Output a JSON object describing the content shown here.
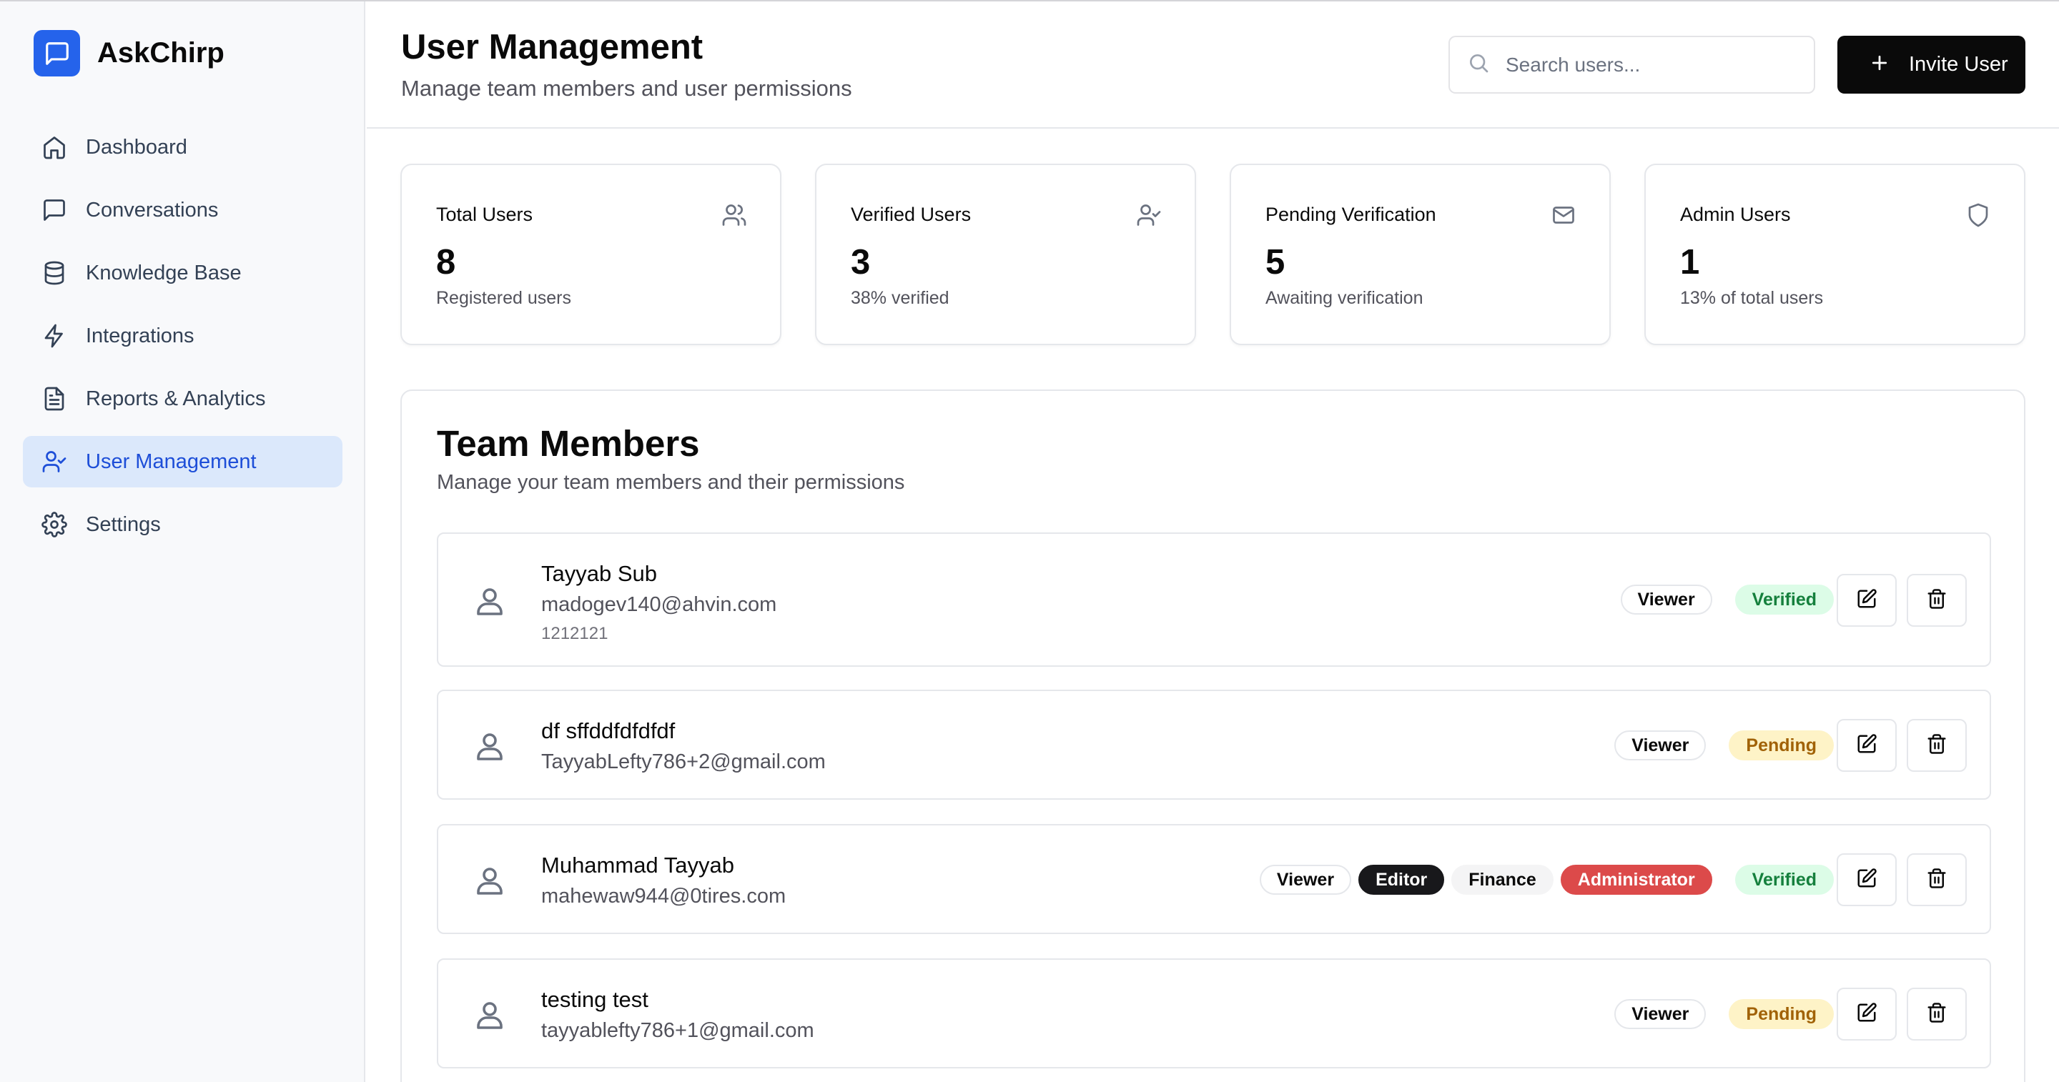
{
  "brand": {
    "name": "AskChirp",
    "logo_icon": "chat-bubble-icon",
    "accent_color": "#2563eb"
  },
  "sidebar": {
    "items": [
      {
        "label": "Dashboard",
        "icon": "home-icon",
        "active": false
      },
      {
        "label": "Conversations",
        "icon": "message-square-icon",
        "active": false
      },
      {
        "label": "Knowledge Base",
        "icon": "database-icon",
        "active": false
      },
      {
        "label": "Integrations",
        "icon": "lightning-icon",
        "active": false
      },
      {
        "label": "Reports & Analytics",
        "icon": "file-text-icon",
        "active": false
      },
      {
        "label": "User Management",
        "icon": "user-check-icon",
        "active": true
      },
      {
        "label": "Settings",
        "icon": "gear-icon",
        "active": false
      }
    ]
  },
  "header": {
    "title": "User Management",
    "subtitle": "Manage team members and user permissions",
    "search_placeholder": "Search users...",
    "invite_label": "Invite User"
  },
  "stats": [
    {
      "title": "Total Users",
      "value": "8",
      "desc": "Registered users",
      "icon": "users-icon"
    },
    {
      "title": "Verified Users",
      "value": "3",
      "desc": "38% verified",
      "icon": "user-check-icon"
    },
    {
      "title": "Pending Verification",
      "value": "5",
      "desc": "Awaiting verification",
      "icon": "mail-icon"
    },
    {
      "title": "Admin Users",
      "value": "1",
      "desc": "13% of total users",
      "icon": "shield-icon"
    }
  ],
  "team": {
    "title": "Team Members",
    "subtitle": "Manage your team members and their permissions",
    "members": [
      {
        "name": "Tayyab Sub",
        "email": "madogev140@ahvin.com",
        "phone": "1212121",
        "roles": [
          "Viewer"
        ],
        "status": "Verified"
      },
      {
        "name": "df sffddfdfdfdf",
        "email": "TayyabLefty786+2@gmail.com",
        "roles": [
          "Viewer"
        ],
        "status": "Pending"
      },
      {
        "name": "Muhammad Tayyab",
        "email": "mahewaw944@0tires.com",
        "roles": [
          "Viewer",
          "Editor",
          "Finance",
          "Administrator"
        ],
        "status": "Verified"
      },
      {
        "name": "testing test",
        "email": "tayyablefty786+1@gmail.com",
        "roles": [
          "Viewer"
        ],
        "status": "Pending"
      }
    ]
  },
  "colors": {
    "verified_bg": "#dcfce7",
    "verified_text": "#15803d",
    "pending_bg": "#fef3c7",
    "pending_text": "#a16207",
    "admin_badge": "#dc4a4a"
  }
}
